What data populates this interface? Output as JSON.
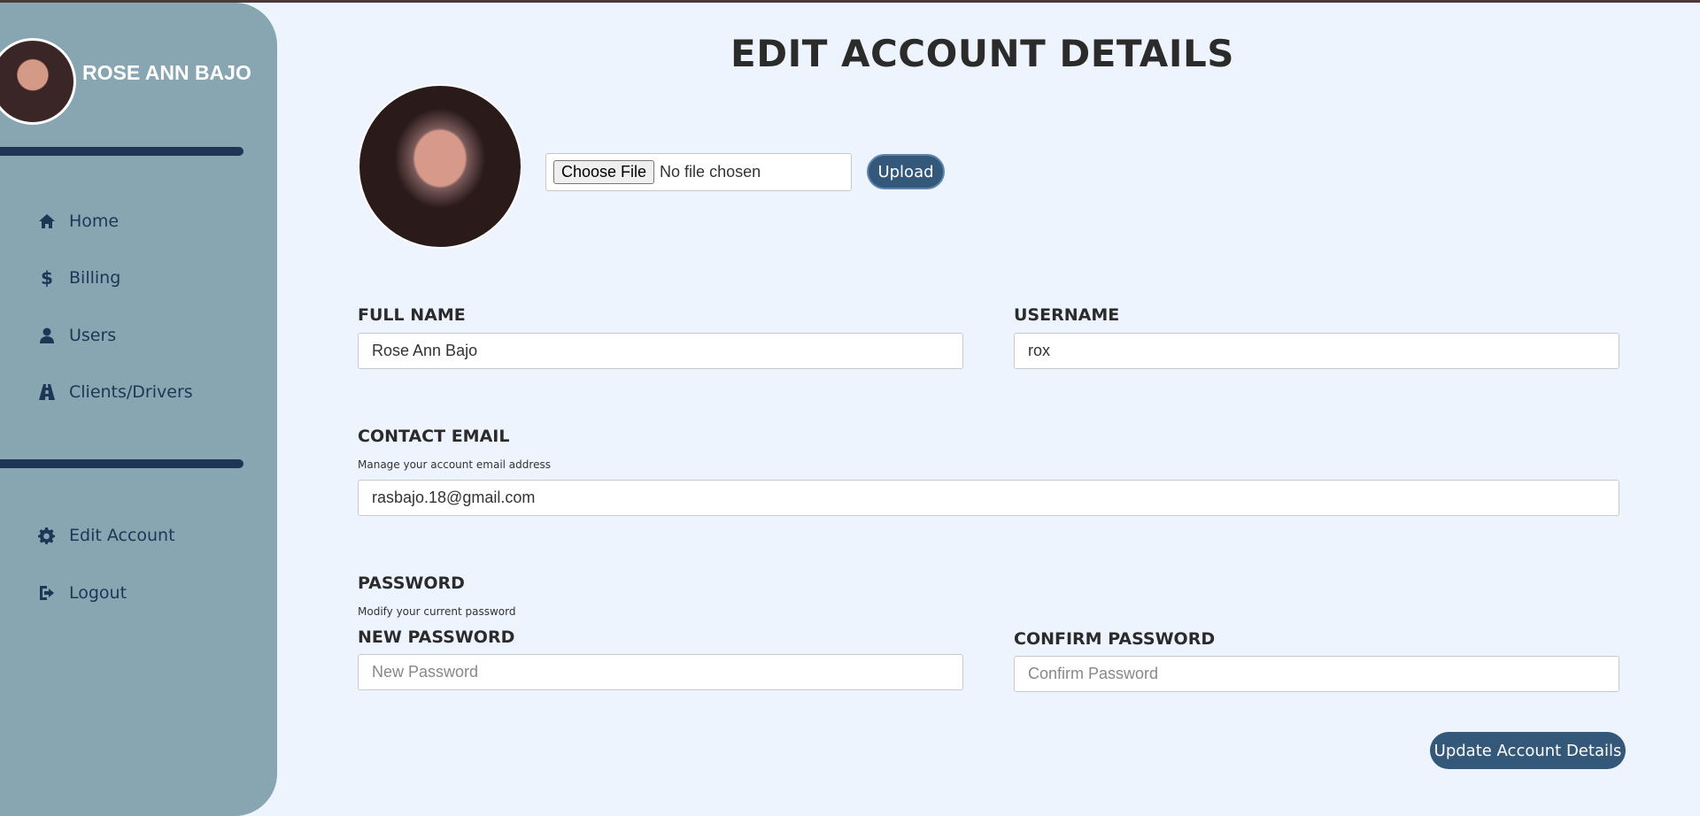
{
  "colors": {
    "sidebar": "#88a6b1",
    "accent": "#1e3555",
    "button": "#34587a",
    "background": "#eef4fd"
  },
  "sidebar": {
    "profile_name": "ROSE ANN BAJO",
    "items": [
      {
        "label": "Home",
        "icon": "home-icon"
      },
      {
        "label": "Billing",
        "icon": "dollar-icon"
      },
      {
        "label": "Users",
        "icon": "user-icon"
      },
      {
        "label": "Clients/Drivers",
        "icon": "road-icon"
      },
      {
        "label": "Edit Account",
        "icon": "gear-icon"
      },
      {
        "label": "Logout",
        "icon": "logout-icon"
      }
    ]
  },
  "main": {
    "title": "EDIT ACCOUNT DETAILS",
    "file_input": {
      "button_label": "Choose File",
      "status": "No file chosen"
    },
    "upload_label": "Upload",
    "full_name": {
      "label": "FULL NAME",
      "value": "Rose Ann Bajo"
    },
    "username": {
      "label": "USERNAME",
      "value": "rox"
    },
    "email": {
      "label": "CONTACT EMAIL",
      "help": "Manage your account email address",
      "value": "rasbajo.18@gmail.com"
    },
    "password": {
      "label": "PASSWORD",
      "help": "Modify your current password",
      "new_label": "NEW PASSWORD",
      "new_placeholder": "New Password",
      "confirm_label": "CONFIRM PASSWORD",
      "confirm_placeholder": "Confirm Password"
    },
    "update_label": "Update Account Details"
  }
}
